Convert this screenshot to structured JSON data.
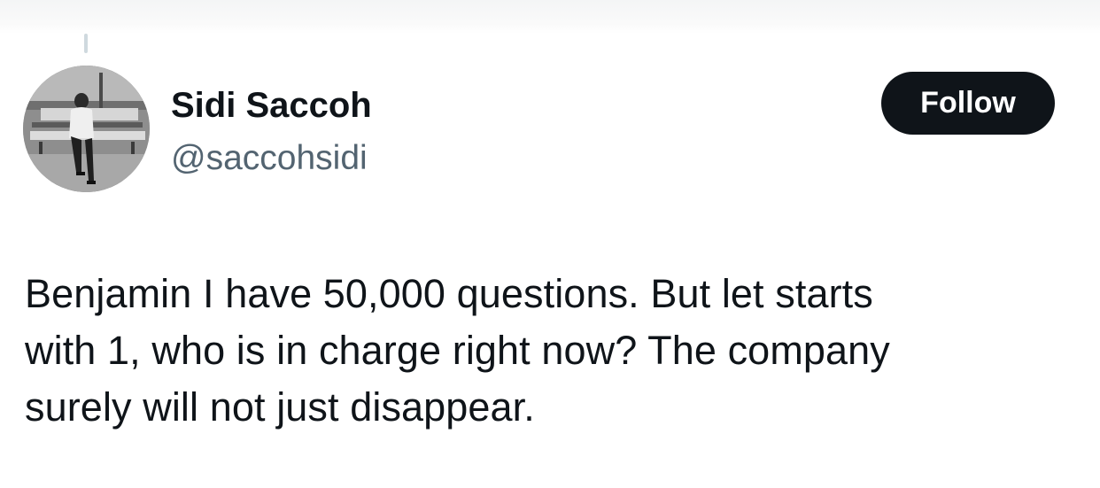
{
  "author": {
    "display_name": "Sidi Saccoh",
    "handle": "@saccohsidi",
    "avatar_icon": "user-avatar-photo"
  },
  "actions": {
    "follow_label": "Follow"
  },
  "tweet": {
    "lines": [
      "Benjamin I have 50,000 questions. But let starts",
      "with 1, who is in charge right now? The company",
      "surely will not just disappear."
    ]
  },
  "colors": {
    "text_primary": "#0f1419",
    "text_secondary": "#536471",
    "button_bg": "#0f1419",
    "button_text": "#ffffff",
    "thread_line": "#cfd9de"
  }
}
